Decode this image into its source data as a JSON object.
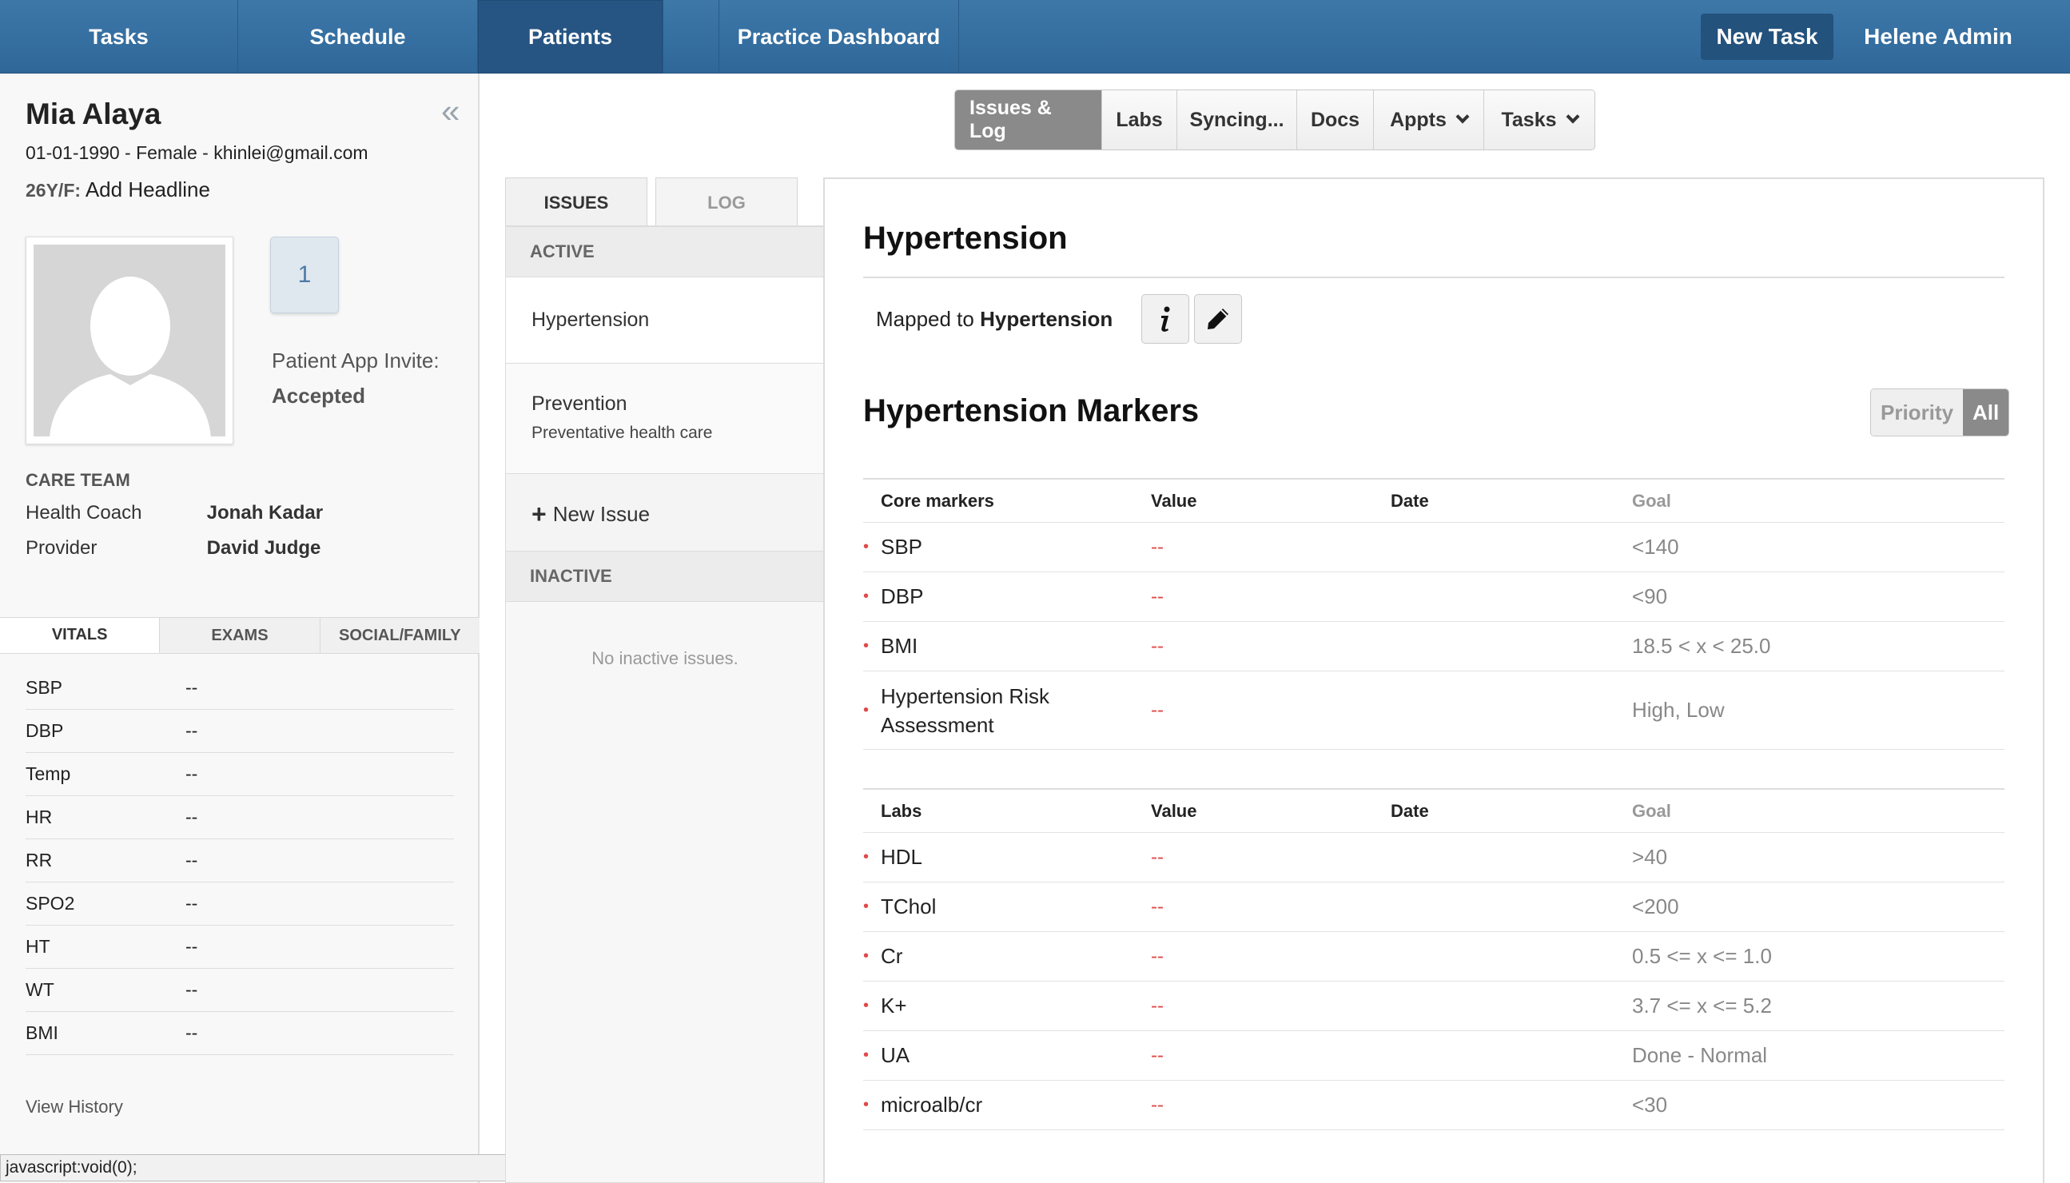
{
  "nav": {
    "tabs": [
      {
        "label": "Tasks"
      },
      {
        "label": "Schedule"
      },
      {
        "label": "Patients"
      },
      {
        "label": "Practice Dashboard"
      }
    ],
    "active_tab": "Patients",
    "new_task_label": "New Task",
    "user_label": "Helene Admin",
    "accent_color": "#3d78a9"
  },
  "patient": {
    "name": "Mia Alaya",
    "info": "01-01-1990 - Female - khinlei@gmail.com",
    "age_sex": "26Y/F:",
    "headline_action": "Add Headline",
    "badge_count": "1",
    "invite_label": "Patient App Invite:",
    "invite_status": "Accepted",
    "care_team_title": "CARE TEAM",
    "care_team": [
      {
        "role": "Health Coach",
        "name": "Jonah Kadar"
      },
      {
        "role": "Provider",
        "name": "David Judge"
      }
    ]
  },
  "vitals": {
    "tabs": [
      "VITALS",
      "EXAMS",
      "SOCIAL/FAMILY"
    ],
    "active_tab": "VITALS",
    "rows": [
      {
        "name": "SBP",
        "value": "--"
      },
      {
        "name": "DBP",
        "value": "--"
      },
      {
        "name": "Temp",
        "value": "--"
      },
      {
        "name": "HR",
        "value": "--"
      },
      {
        "name": "RR",
        "value": "--"
      },
      {
        "name": "SPO2",
        "value": "--"
      },
      {
        "name": "HT",
        "value": "--"
      },
      {
        "name": "WT",
        "value": "--"
      },
      {
        "name": "BMI",
        "value": "--"
      }
    ],
    "view_history": "View History"
  },
  "status_bar": "javascript:void(0);",
  "record_tabs": [
    {
      "label": "Issues & Log",
      "active": true
    },
    {
      "label": "Labs"
    },
    {
      "label": "Syncing..."
    },
    {
      "label": "Docs"
    },
    {
      "label": "Appts",
      "dropdown": true
    },
    {
      "label": "Tasks",
      "dropdown": true
    }
  ],
  "issues": {
    "tabs": [
      "ISSUES",
      "LOG"
    ],
    "active_tab": "ISSUES",
    "active_header": "ACTIVE",
    "active_items": [
      {
        "title": "Hypertension",
        "subtitle": ""
      },
      {
        "title": "Prevention",
        "subtitle": "Preventative health care"
      }
    ],
    "new_issue": "New Issue",
    "inactive_header": "INACTIVE",
    "inactive_empty": "No inactive issues."
  },
  "detail": {
    "title": "Hypertension",
    "mapped_prefix": "Mapped to",
    "mapped_value": "Hypertension",
    "info_icon": "info-icon",
    "edit_icon": "pencil-icon",
    "markers_title": "Hypertension Markers",
    "filter_options": [
      "Priority",
      "All"
    ],
    "filter_selected": "All",
    "value_color": "#e04a4a",
    "core": {
      "headers": [
        "Core markers",
        "Value",
        "Date",
        "Goal"
      ],
      "rows": [
        {
          "name": "SBP",
          "value": "--",
          "date": "",
          "goal": "<140"
        },
        {
          "name": "DBP",
          "value": "--",
          "date": "",
          "goal": "<90"
        },
        {
          "name": "BMI",
          "value": "--",
          "date": "",
          "goal": "18.5 < x < 25.0"
        },
        {
          "name": "Hypertension Risk Assessment",
          "value": "--",
          "date": "",
          "goal": "High, Low"
        }
      ]
    },
    "labs": {
      "headers": [
        "Labs",
        "Value",
        "Date",
        "Goal"
      ],
      "rows": [
        {
          "name": "HDL",
          "value": "--",
          "date": "",
          "goal": ">40"
        },
        {
          "name": "TChol",
          "value": "--",
          "date": "",
          "goal": "<200"
        },
        {
          "name": "Cr",
          "value": "--",
          "date": "",
          "goal": "0.5 <= x <= 1.0"
        },
        {
          "name": "K+",
          "value": "--",
          "date": "",
          "goal": "3.7 <= x <= 5.2"
        },
        {
          "name": "UA",
          "value": "--",
          "date": "",
          "goal": "Done - Normal"
        },
        {
          "name": "microalb/cr",
          "value": "--",
          "date": "",
          "goal": "<30"
        }
      ]
    }
  }
}
